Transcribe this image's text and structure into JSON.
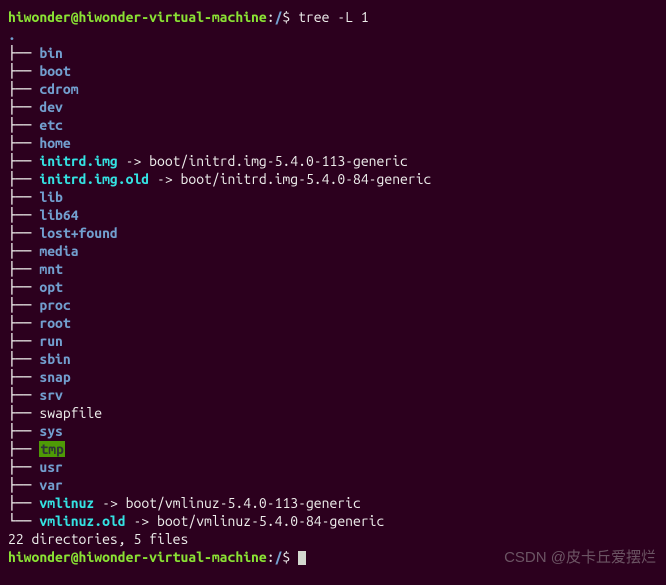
{
  "prompt1": {
    "user": "hiwonder@hiwonder-virtual-machine",
    "sep": ":",
    "path": "/",
    "sym": "$",
    "command": " tree -L 1"
  },
  "dot": ".",
  "tree": {
    "branch": "├── ",
    "last": "└── ",
    "entries": [
      {
        "name": "bin",
        "type": "dir"
      },
      {
        "name": "boot",
        "type": "dir"
      },
      {
        "name": "cdrom",
        "type": "dir"
      },
      {
        "name": "dev",
        "type": "dir"
      },
      {
        "name": "etc",
        "type": "dir"
      },
      {
        "name": "home",
        "type": "dir"
      },
      {
        "name": "initrd.img",
        "type": "link",
        "arrow": " -> ",
        "target": "boot/initrd.img-5.4.0-113-generic"
      },
      {
        "name": "initrd.img.old",
        "type": "link",
        "arrow": " -> ",
        "target": "boot/initrd.img-5.4.0-84-generic"
      },
      {
        "name": "lib",
        "type": "dir"
      },
      {
        "name": "lib64",
        "type": "dir"
      },
      {
        "name": "lost+found",
        "type": "dir"
      },
      {
        "name": "media",
        "type": "dir"
      },
      {
        "name": "mnt",
        "type": "dir"
      },
      {
        "name": "opt",
        "type": "dir"
      },
      {
        "name": "proc",
        "type": "dir"
      },
      {
        "name": "root",
        "type": "dir"
      },
      {
        "name": "run",
        "type": "dir"
      },
      {
        "name": "sbin",
        "type": "dir"
      },
      {
        "name": "snap",
        "type": "dir"
      },
      {
        "name": "srv",
        "type": "dir"
      },
      {
        "name": "swapfile",
        "type": "file"
      },
      {
        "name": "sys",
        "type": "dir"
      },
      {
        "name": "tmp",
        "type": "sticky"
      },
      {
        "name": "usr",
        "type": "dir"
      },
      {
        "name": "var",
        "type": "dir"
      },
      {
        "name": "vmlinuz",
        "type": "link",
        "arrow": " -> ",
        "target": "boot/vmlinuz-5.4.0-113-generic"
      },
      {
        "name": "vmlinuz.old",
        "type": "link",
        "arrow": " -> ",
        "target": "boot/vmlinuz-5.4.0-84-generic"
      }
    ]
  },
  "summary_blank": "",
  "summary": "22 directories, 5 files",
  "prompt2": {
    "user": "hiwonder@hiwonder-virtual-machine",
    "sep": ":",
    "path": "/",
    "sym": "$",
    "command": " "
  },
  "watermark": "CSDN @皮卡丘爱摆烂"
}
